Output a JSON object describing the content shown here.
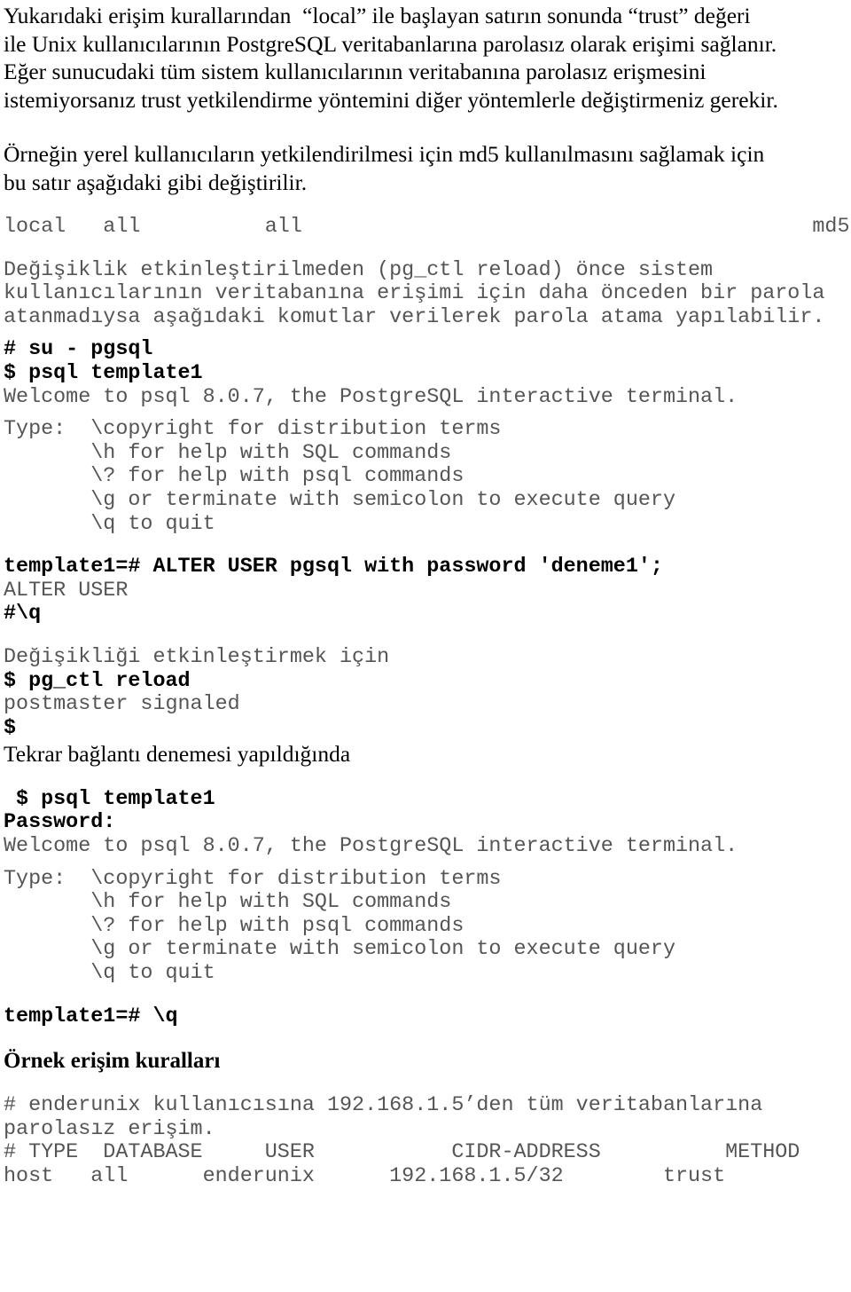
{
  "document": {
    "language": "tr",
    "paragraph_1": "Yukarıdaki erişim kurallarından  “local” ile başlayan satırın sonunda “trust” değeri\nile Unix kullanıcılarının PostgreSQL veritabanlarına parolasız olarak erişimi sağlanır.\nEğer sunucudaki tüm sistem kullanıcılarının veritabanına parolasız erişmesini\nistemiyorsanız trust yetkilendirme yöntemini diğer yöntemlerle değiştirmeniz gerekir.",
    "paragraph_2": "Örneğin yerel kullanıcıların yetkilendirilmesi için md5 kullanılmasını sağlamak için\nbu satır aşağıdaki gibi değiştirilir.",
    "pg_hba_md5_line": "local   all          all                                         md5",
    "paragraph_3": "Değişiklik etkinleştirilmeden (pg_ctl reload) önce sistem\nkullanıcılarının veritabanına erişimi için daha önceden bir parola\natanmadıysa aşağıdaki komutlar verilerek parola atama yapılabilir.",
    "terminal_session_1": {
      "cmd_su": "# su - pgsql",
      "cmd_psql": "$ psql template1",
      "welcome": "Welcome to psql 8.0.7, the PostgreSQL interactive terminal.",
      "type_help": "Type:  \\copyright for distribution terms\n       \\h for help with SQL commands\n       \\? for help with psql commands\n       \\g or terminate with semicolon to execute query\n       \\q to quit",
      "alter_user_cmd": "template1=# ALTER USER pgsql with password 'deneme1';",
      "alter_user_result": "ALTER USER",
      "quit_cmd": "#\\q"
    },
    "reload_note": "Değişikliği etkinleştirmek için",
    "terminal_session_2": {
      "cmd_reload": "$ pg_ctl reload",
      "reload_result": "postmaster signaled",
      "prompt": "$"
    },
    "paragraph_4": "Tekrar bağlantı denemesi yapıldığında",
    "terminal_session_3": {
      "cmd_psql": " $ psql template1",
      "password_prompt": "Password:",
      "welcome": "Welcome to psql 8.0.7, the PostgreSQL interactive terminal.",
      "type_help": "Type:  \\copyright for distribution terms\n       \\h for help with SQL commands\n       \\? for help with psql commands\n       \\g or terminate with semicolon to execute query\n       \\q to quit",
      "quit_cmd": "template1=# \\q"
    },
    "heading_examples": "Örnek erişim kuralları",
    "examples": {
      "comment_1": "# enderunix kullanıcısına 192.168.1.5’den tüm veritabanlarına\nparolasız erişim.",
      "table_header": "# TYPE  DATABASE     USER           CIDR-ADDRESS          METHOD",
      "row_1": "host   all      enderunix      192.168.1.5/32        trust"
    }
  }
}
